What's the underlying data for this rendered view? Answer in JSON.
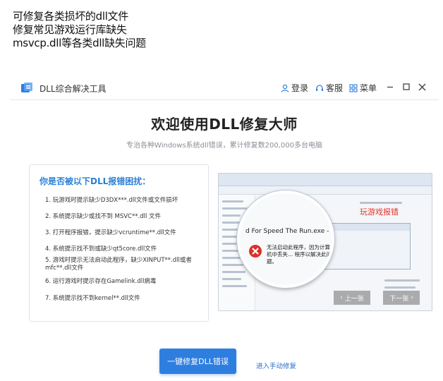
{
  "caption": {
    "lines": [
      "可修复各类损坏的dll文件",
      "修复常见游戏运行库缺失",
      "msvcp.dll等各类dll缺失问题"
    ]
  },
  "app": {
    "name": "DLL综合解决工具",
    "toolbar": {
      "login_label": "登录",
      "service_label": "客服",
      "menu_label": "菜单"
    },
    "icons": {
      "app": "app-logo-icon",
      "login": "user-icon",
      "service": "headset-icon",
      "menu": "menu-icon",
      "minimize": "minimize-icon",
      "maximize": "maximize-icon",
      "close": "close-icon"
    }
  },
  "hero": {
    "title": "欢迎使用DLL修复大师",
    "subtitle": "专治各种Windows系统dll错误，累计修复数200,000多台电脑"
  },
  "issues": {
    "title": "你是否被以下DLL报错困扰：",
    "items": [
      "1. 玩游戏时提示缺少D3DX***.dll文件或文件损坏",
      "2. 系统提示缺少或找不到 MSVC**.dll 文件",
      "3. 打开程序报错，提示缺少vcruntime**.dll文件",
      "4. 系统提示找不到或缺少qt5core.dll文件",
      "5. 游戏时提示无法启动此程序，缺少XINPUT**.dll或者mfc**.dll文件",
      "6. 运行游戏时提示存在Gamelink.dll病毒",
      "7. 系统提示找不到kernel**.dll文件"
    ]
  },
  "screenshot": {
    "window_title": "d For Speed The Run.exe - 系统错误",
    "error_text": "无法启动此程序，因为计算机中丢失... 程序以解决此问题。",
    "label": "玩游戏报错",
    "prev_label": "上一张",
    "next_label": "下一张"
  },
  "actions": {
    "primary_label": "一键修复DLL错误",
    "secondary_label": "进入手动修复"
  },
  "colors": {
    "accent": "#2e7ee0",
    "issue_title": "#2a7fd4",
    "error_label": "#e4342a"
  }
}
